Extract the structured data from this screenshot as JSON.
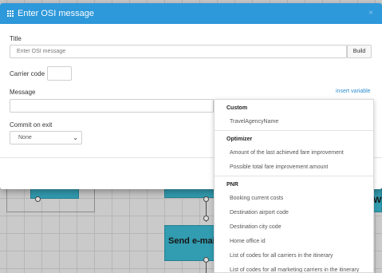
{
  "background": {
    "node_label": "Send e-mail t",
    "partial_label": "W"
  },
  "modal": {
    "title": "Enter OSI message",
    "close": "×",
    "title_field": {
      "label": "Title",
      "placeholder": "Enter OSI message",
      "build_label": "Build"
    },
    "carrier_code": {
      "label": "Carrier code",
      "value": ""
    },
    "message": {
      "label": "Message",
      "value": "",
      "insert_variable": "insert variable"
    },
    "commit_on_exit": {
      "label": "Commit on exit",
      "selected": "None"
    }
  },
  "variable_menu": {
    "groups": [
      {
        "name": "Custom",
        "items": [
          "TravelAgencyName"
        ]
      },
      {
        "name": "Optimizer",
        "items": [
          "Amount of the last achieved fare improvement",
          "Possible total fare improvement amount"
        ]
      },
      {
        "name": "PNR",
        "items": [
          "Booking current costs",
          "Destination airport code",
          "Destination city code",
          "Home office id",
          "List of codes for all carriers in the itinerary",
          "List of codes for all marketing carriers in the itinerary"
        ]
      }
    ]
  },
  "colors": {
    "header": "#2d98da",
    "node": "#39b2c9",
    "link": "#2d8ed0"
  }
}
